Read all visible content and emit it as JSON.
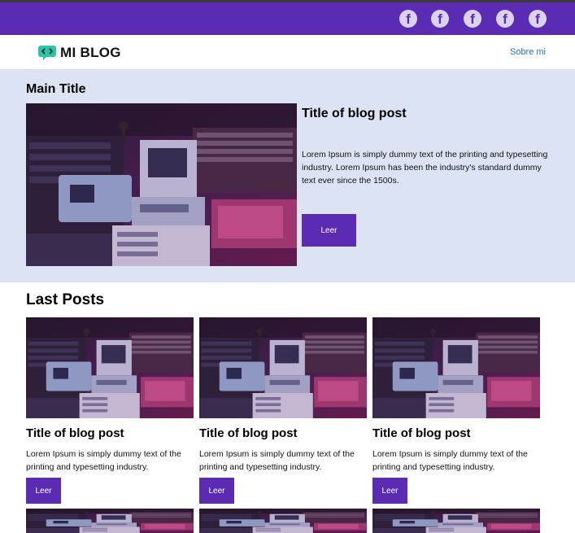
{
  "social_bar": {
    "icons": [
      "facebook-icon",
      "facebook-icon",
      "facebook-icon",
      "facebook-icon",
      "facebook-icon"
    ],
    "icon_glyph": "f"
  },
  "nav": {
    "logo_text": "MI BLOG",
    "link": "Sobre mi"
  },
  "hero": {
    "main_title": "Main Title",
    "post_title": "Title of blog post",
    "text": "Lorem Ipsum is simply dummy text of the printing and typesetting industry. Lorem Ipsum has been the industry's standard dummy text ever since the 1500s.",
    "button": "Leer"
  },
  "last_posts": {
    "title": "Last Posts",
    "posts": [
      {
        "title": "Title of blog post",
        "text": "Lorem Ipsum is simply dummy text of the printing and typesetting industry.",
        "button": "Leer"
      },
      {
        "title": "Title of blog post",
        "text": "Lorem Ipsum is simply dummy text of the printing and typesetting industry.",
        "button": "Leer"
      },
      {
        "title": "Title of blog post",
        "text": "Lorem Ipsum is simply dummy text of the printing and typesetting industry.",
        "button": "Leer"
      }
    ]
  },
  "colors": {
    "accent": "#5b2cb3",
    "hero_bg": "#dce3f3",
    "link": "#1e6fd0",
    "logo_mark": "#2ec4a6"
  }
}
